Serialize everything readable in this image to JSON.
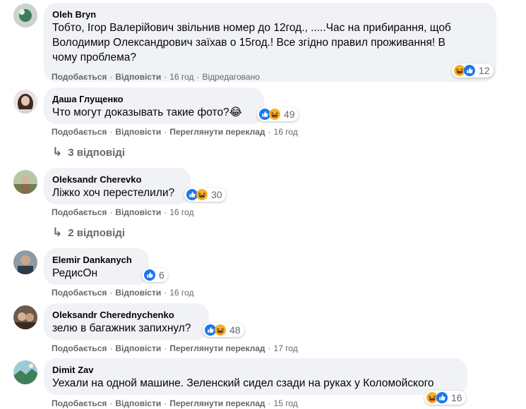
{
  "actions": {
    "like": "Подобається",
    "reply": "Відповісти",
    "translate": "Переглянути переклад",
    "edited": "Відредаговано"
  },
  "comments": [
    {
      "author": "Oleh Bryn",
      "text": "Тобто, Ігор Валерійович звільнив номер до 12год., .....Час на прибирання, щоб\nВолодимир Олександрович заїхав о 15год.! Все згідно правил проживання! В\nчому проблема?",
      "time": "16 год",
      "reactions": "12"
    },
    {
      "author": "Даша Глущенко",
      "text": "Что могут доказывать такие фото?😂",
      "time": "16 год",
      "reactions": "49",
      "replies": "3 відповіді"
    },
    {
      "author": "Oleksandr Cherevko",
      "text": "Ліжко хоч перестелили?",
      "time": "16 год",
      "reactions": "30",
      "replies": "2 відповіді"
    },
    {
      "author": "Elemir Dankanych",
      "text": "РедисОн",
      "time": "16 год",
      "reactions": "6"
    },
    {
      "author": "Oleksandr Cherednychenko",
      "text": "зелю в багажник запихнул?",
      "time": "17 год",
      "reactions": "48"
    },
    {
      "author": "Dimit Zav",
      "text": "Уехали на одной машине. Зеленский сидел сзади на руках у Коломойского",
      "time": "15 год",
      "reactions": "16"
    }
  ],
  "colors": {
    "bubble": "#f0f2f5",
    "like_blue": "#1877f2",
    "haha_yellow": "#f7b125",
    "meta_gray": "#65676b"
  }
}
